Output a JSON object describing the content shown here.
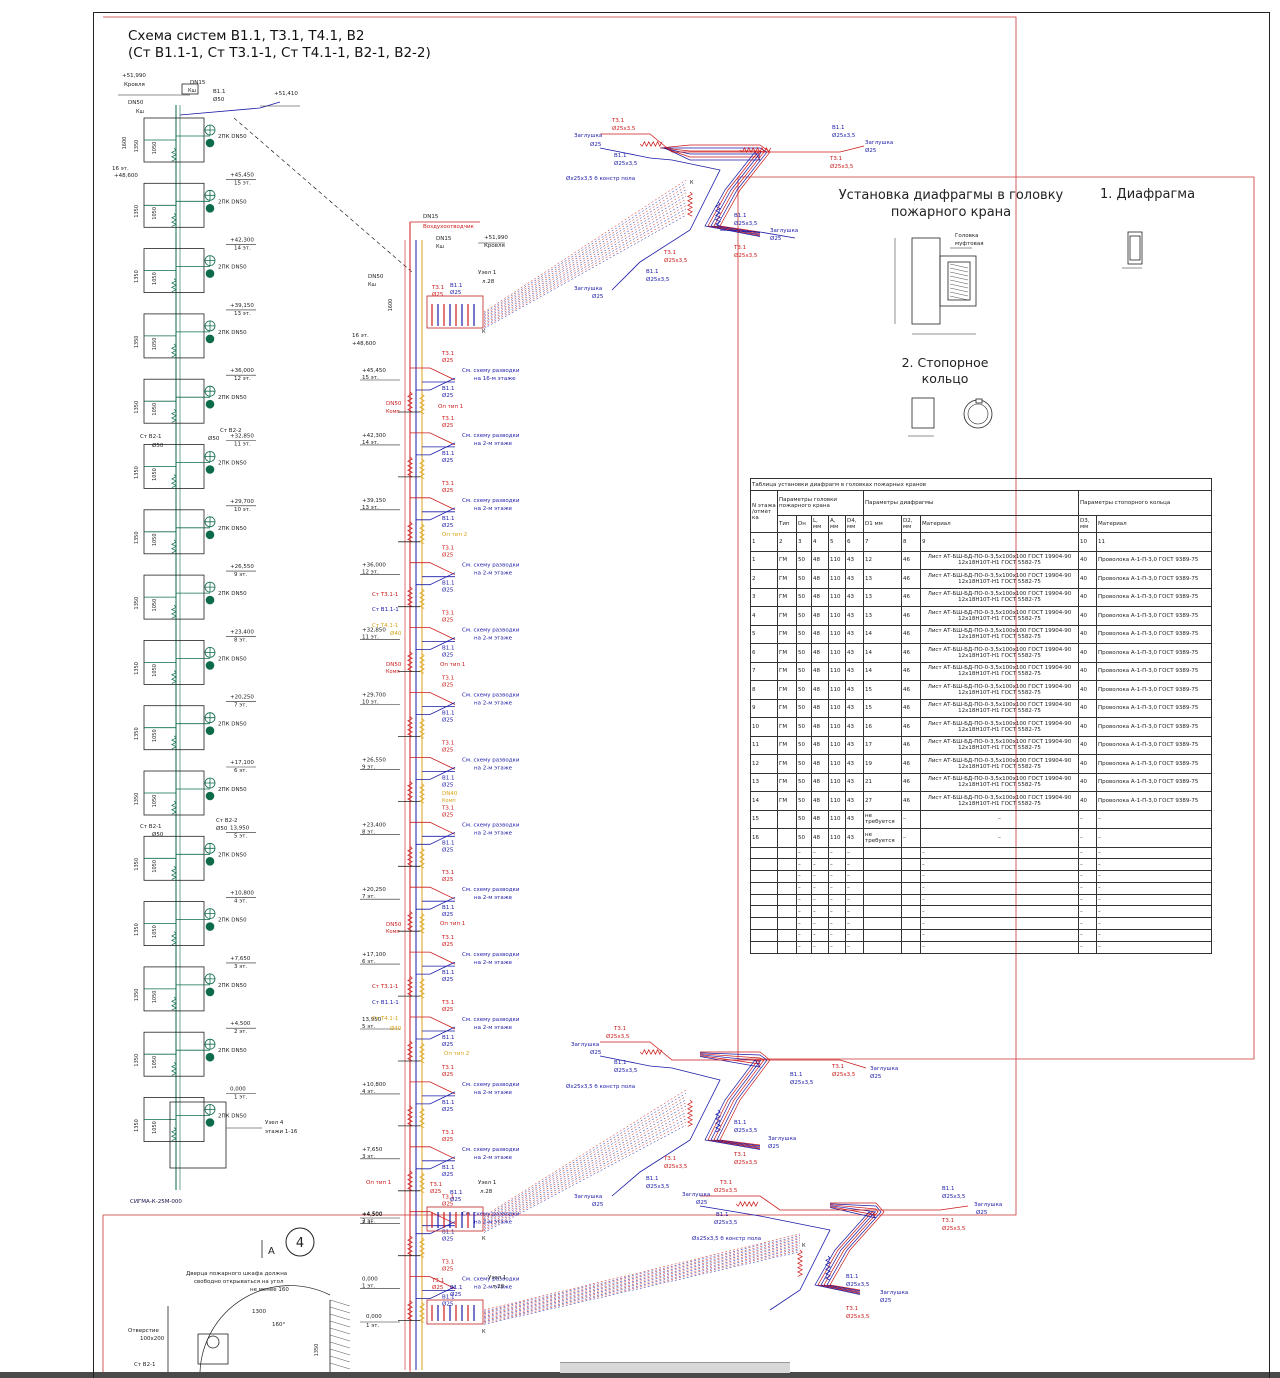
{
  "title": {
    "line1": "Схема систем В1.1, Т3.1, Т4.1, В2",
    "line2": "(Ст В1.1-1, Ст Т3.1-1, Ст Т4.1-1, В2-1, В2-2)"
  },
  "colors": {
    "b1": "#1a1aa8",
    "t3": "#cc1a1a",
    "t4": "#d9a21a",
    "b2": "#0e6b4a",
    "frame": "#cc3333",
    "line": "#222222"
  },
  "diaphragm": {
    "title_line1": "Установка диафрагмы в головку",
    "title_line2": "пожарного крана",
    "caption1": "1. Диафрагма",
    "caption2_line1": "2. Стопорное",
    "caption2_line2": "кольцо",
    "head_label_1": "Головка",
    "head_label_2": "муфтовая"
  },
  "left_riser": {
    "roof": "+51,990",
    "roof_label": "Кровля",
    "dn15": "DN15",
    "ksh": "Кш",
    "dn50": "DN50",
    "top_b1": "В1.1",
    "top_d": "Ø50",
    "top_level": "+51,410",
    "level16": "16 эт.",
    "level16_mark": "+48,600",
    "hydrant": "2ПК DN50",
    "dim_big": "1600",
    "dim": "1350",
    "dim2": "1050",
    "floors": [
      {
        "mark": "+45,450",
        "floor": "15 эт."
      },
      {
        "mark": "+42,300",
        "floor": "14 эт."
      },
      {
        "mark": "+39,150",
        "floor": "13 эт."
      },
      {
        "mark": "+36,000",
        "floor": "12 эт."
      },
      {
        "mark": "+32,850",
        "floor": "11 эт."
      },
      {
        "mark": "+29,700",
        "floor": "10 эт."
      },
      {
        "mark": "+26,550",
        "floor": "9 эт."
      },
      {
        "mark": "+23,400",
        "floor": "8 эт."
      },
      {
        "mark": "+20,250",
        "floor": "7 эт."
      },
      {
        "mark": "+17,100",
        "floor": "6 эт."
      },
      {
        "mark": "13,950",
        "floor": "5 эт."
      },
      {
        "mark": "+10,800",
        "floor": "4 эт."
      },
      {
        "mark": "+7,650",
        "floor": "3 эт."
      },
      {
        "mark": "+4,500",
        "floor": "2 эт."
      },
      {
        "mark": "0,000",
        "floor": "1 эт."
      }
    ],
    "st_b2_2": "Ст В2-2",
    "st_b2_1": "Ст В2-1",
    "d50": "Ø50",
    "node4": "Узел 4",
    "node4_sub": "этажи 1-16",
    "stamp": "СИГМА-К-25М-000"
  },
  "center_riser": {
    "dn15": "DN15",
    "air_vent": "Воздухоотводчик",
    "dn15b": "DN15",
    "ksh": "Кш",
    "roof": "+51,990",
    "roof_label": "Кровля",
    "dn50": "DN50",
    "ksh2": "Кш",
    "t31": "Т3.1",
    "b11": "В1.1",
    "d25": "Ø25",
    "node1": "Узел 1",
    "node1_sub": "л.28",
    "level16": "16 эт.",
    "level16_mark": "+48,600",
    "dim": "1600",
    "see_16": "См. схему разводки",
    "see_16b": "на 16-м этаже",
    "see": "См. схему разводки",
    "see_b": "на 2-м этаже",
    "floors": [
      {
        "mark": "+45,450",
        "floor": "15 эт."
      },
      {
        "mark": "+42,300",
        "floor": "14 эт."
      },
      {
        "mark": "+39,150",
        "floor": "13 эт."
      },
      {
        "mark": "+36,000",
        "floor": "12 эт."
      },
      {
        "mark": "+32,850",
        "floor": "11 эт."
      },
      {
        "mark": "+29,700",
        "floor": "10 эт."
      },
      {
        "mark": "+26,550",
        "floor": "9 эт."
      },
      {
        "mark": "+23,400",
        "floor": "8 эт."
      },
      {
        "mark": "+20,250",
        "floor": "7 эт."
      },
      {
        "mark": "+17,100",
        "floor": "6 эт."
      },
      {
        "mark": "13,950",
        "floor": "5 эт."
      },
      {
        "mark": "+10,800",
        "floor": "4 эт."
      },
      {
        "mark": "+7,650",
        "floor": "3 эт."
      },
      {
        "mark": "+4,500",
        "floor": "2 эт."
      },
      {
        "mark": "0,000",
        "floor": "1 эт."
      }
    ],
    "dn50k": "DN50",
    "komp": "Комп",
    "op1": "Оп тип 1",
    "op2": "Оп тип 2",
    "dn40": "DN40",
    "st_t31": "Ст Т3.1-1",
    "st_b11": "Ст В1.1-1",
    "st_t41": "Ст Т4.1-1",
    "d40": "Ø40",
    "stamp": "СИГМА-К-25М-000"
  },
  "branches": {
    "zaglushka": "Заглушка",
    "d25": "Ø25",
    "t31": "Т3.1",
    "b11": "В1.1",
    "d25x35": "Ø25х3,5",
    "floor_note": "Øх25х3,5 б констр пола",
    "floor_note2": "Øх25х3,5 б констр пола",
    "k": "К"
  },
  "section": {
    "arrow": "А",
    "circle": "4",
    "note1": "Дверца пожарного шкафа должна",
    "note2": "свободно открываться на угол",
    "note3": "не менее 160",
    "dim1300": "1300",
    "angle": "160°",
    "otv": "Отверстие",
    "otv2": "100х200",
    "st_b2": "Ст В2-1",
    "dim1350": "1350"
  },
  "table": {
    "caption": "Таблица установки диафрагм в головках пожарных кранов",
    "h_floor": "N этажа /отмет ка",
    "h_head": "Параметры головки пожарного крана",
    "h_diaphragm": "Параметры диафрагмы",
    "h_ring": "Параметры стопорного кольца",
    "cols": [
      "Тип",
      "Dн",
      "L, мм",
      "A, мм",
      "D4, мм",
      "D1 мм",
      "D2, мм",
      "Материал",
      "D3, мм",
      "Материал"
    ],
    "nums": [
      "1",
      "2",
      "3",
      "4",
      "5",
      "6",
      "7",
      "8",
      "9",
      "10",
      "11"
    ],
    "rows": [
      [
        "1",
        "ГМ",
        "50",
        "48",
        "110",
        "43",
        "12",
        "46",
        "Лист АТ-БШ-БД-ПО-0-3,5х100х100 ГОСТ 19904-90 12х18Н10Т-Н1 ГОСТ 5582-75",
        "40",
        "Проволока А-1-П-3,0 ГОСТ 9389-75"
      ],
      [
        "2",
        "ГМ",
        "50",
        "48",
        "110",
        "43",
        "13",
        "46",
        "Лист АТ-БШ-БД-ПО-0-3,5х100х100 ГОСТ 19904-90 12х18Н10Т-Н1 ГОСТ 5582-75",
        "40",
        "Проволока А-1-П-3,0 ГОСТ 9389-75"
      ],
      [
        "3",
        "ГМ",
        "50",
        "48",
        "110",
        "43",
        "13",
        "46",
        "Лист АТ-БШ-БД-ПО-0-3,5х100х100 ГОСТ 19904-90 12х18Н10Т-Н1 ГОСТ 5582-75",
        "40",
        "Проволока А-1-П-3,0 ГОСТ 9389-75"
      ],
      [
        "4",
        "ГМ",
        "50",
        "48",
        "110",
        "43",
        "13",
        "46",
        "Лист АТ-БШ-БД-ПО-0-3,5х100х100 ГОСТ 19904-90 12х18Н10Т-Н1 ГОСТ 5582-75",
        "40",
        "Проволока А-1-П-3,0 ГОСТ 9389-75"
      ],
      [
        "5",
        "ГМ",
        "50",
        "48",
        "110",
        "43",
        "14",
        "46",
        "Лист АТ-БШ-БД-ПО-0-3,5х100х100 ГОСТ 19904-90 12х18Н10Т-Н1 ГОСТ 5582-75",
        "40",
        "Проволока А-1-П-3,0 ГОСТ 9389-75"
      ],
      [
        "6",
        "ГМ",
        "50",
        "48",
        "110",
        "43",
        "14",
        "46",
        "Лист АТ-БШ-БД-ПО-0-3,5х100х100 ГОСТ 19904-90 12х18Н10Т-Н1 ГОСТ 5582-75",
        "40",
        "Проволока А-1-П-3,0 ГОСТ 9389-75"
      ],
      [
        "7",
        "ГМ",
        "50",
        "48",
        "110",
        "43",
        "14",
        "46",
        "Лист АТ-БШ-БД-ПО-0-3,5х100х100 ГОСТ 19904-90 12х18Н10Т-Н1 ГОСТ 5582-75",
        "40",
        "Проволока А-1-П-3,0 ГОСТ 9389-75"
      ],
      [
        "8",
        "ГМ",
        "50",
        "48",
        "110",
        "43",
        "15",
        "46",
        "Лист АТ-БШ-БД-ПО-0-3,5х100х100 ГОСТ 19904-90 12х18Н10Т-Н1 ГОСТ 5582-75",
        "40",
        "Проволока А-1-П-3,0 ГОСТ 9389-75"
      ],
      [
        "9",
        "ГМ",
        "50",
        "48",
        "110",
        "43",
        "15",
        "46",
        "Лист АТ-БШ-БД-ПО-0-3,5х100х100 ГОСТ 19904-90 12х18Н10Т-Н1 ГОСТ 5582-75",
        "40",
        "Проволока А-1-П-3,0 ГОСТ 9389-75"
      ],
      [
        "10",
        "ГМ",
        "50",
        "48",
        "110",
        "43",
        "16",
        "46",
        "Лист АТ-БШ-БД-ПО-0-3,5х100х100 ГОСТ 19904-90 12х18Н10Т-Н1 ГОСТ 5582-75",
        "40",
        "Проволока А-1-П-3,0 ГОСТ 9389-75"
      ],
      [
        "11",
        "ГМ",
        "50",
        "48",
        "110",
        "43",
        "17",
        "46",
        "Лист АТ-БШ-БД-ПО-0-3,5х100х100 ГОСТ 19904-90 12х18Н10Т-Н1 ГОСТ 5582-75",
        "40",
        "Проволока А-1-П-3,0 ГОСТ 9389-75"
      ],
      [
        "12",
        "ГМ",
        "50",
        "48",
        "110",
        "43",
        "19",
        "46",
        "Лист АТ-БШ-БД-ПО-0-3,5х100х100 ГОСТ 19904-90 12х18Н10Т-Н1 ГОСТ 5582-75",
        "40",
        "Проволока А-1-П-3,0 ГОСТ 9389-75"
      ],
      [
        "13",
        "ГМ",
        "50",
        "48",
        "110",
        "43",
        "21",
        "46",
        "Лист АТ-БШ-БД-ПО-0-3,5х100х100 ГОСТ 19904-90 12х18Н10Т-Н1 ГОСТ 5582-75",
        "40",
        "Проволока А-1-П-3,0 ГОСТ 9389-75"
      ],
      [
        "14",
        "ГМ",
        "50",
        "48",
        "110",
        "43",
        "27",
        "46",
        "Лист АТ-БШ-БД-ПО-0-3,5х100х100 ГОСТ 19904-90 12х18Н10Т-Н1 ГОСТ 5582-75",
        "40",
        "Проволока А-1-П-3,0 ГОСТ 9389-75"
      ],
      [
        "15",
        "",
        "50",
        "48",
        "110",
        "43",
        "не требуется",
        "–",
        "–",
        "–",
        "–"
      ],
      [
        "16",
        "",
        "50",
        "48",
        "110",
        "43",
        "не требуется",
        "–",
        "–",
        "–",
        "–"
      ]
    ],
    "dash": "–",
    "empty_rows": 9
  }
}
